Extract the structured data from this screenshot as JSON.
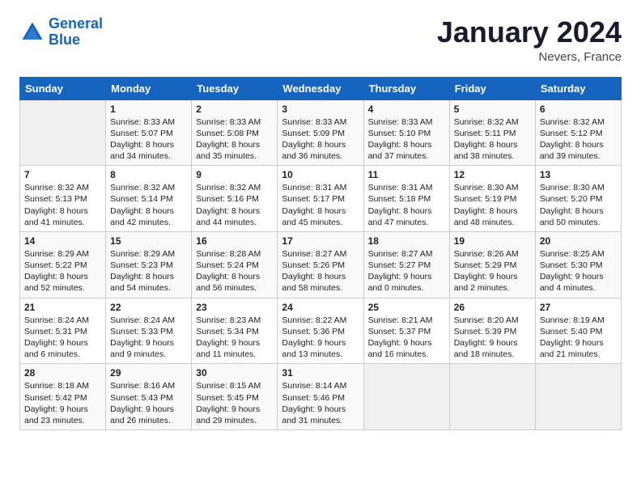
{
  "header": {
    "logo_line1": "General",
    "logo_line2": "Blue",
    "month_title": "January 2024",
    "location": "Nevers, France"
  },
  "days_of_week": [
    "Sunday",
    "Monday",
    "Tuesday",
    "Wednesday",
    "Thursday",
    "Friday",
    "Saturday"
  ],
  "weeks": [
    [
      {
        "day": "",
        "sunrise": "",
        "sunset": "",
        "daylight": ""
      },
      {
        "day": "1",
        "sunrise": "Sunrise: 8:33 AM",
        "sunset": "Sunset: 5:07 PM",
        "daylight": "Daylight: 8 hours and 34 minutes."
      },
      {
        "day": "2",
        "sunrise": "Sunrise: 8:33 AM",
        "sunset": "Sunset: 5:08 PM",
        "daylight": "Daylight: 8 hours and 35 minutes."
      },
      {
        "day": "3",
        "sunrise": "Sunrise: 8:33 AM",
        "sunset": "Sunset: 5:09 PM",
        "daylight": "Daylight: 8 hours and 36 minutes."
      },
      {
        "day": "4",
        "sunrise": "Sunrise: 8:33 AM",
        "sunset": "Sunset: 5:10 PM",
        "daylight": "Daylight: 8 hours and 37 minutes."
      },
      {
        "day": "5",
        "sunrise": "Sunrise: 8:32 AM",
        "sunset": "Sunset: 5:11 PM",
        "daylight": "Daylight: 8 hours and 38 minutes."
      },
      {
        "day": "6",
        "sunrise": "Sunrise: 8:32 AM",
        "sunset": "Sunset: 5:12 PM",
        "daylight": "Daylight: 8 hours and 39 minutes."
      }
    ],
    [
      {
        "day": "7",
        "sunrise": "Sunrise: 8:32 AM",
        "sunset": "Sunset: 5:13 PM",
        "daylight": "Daylight: 8 hours and 41 minutes."
      },
      {
        "day": "8",
        "sunrise": "Sunrise: 8:32 AM",
        "sunset": "Sunset: 5:14 PM",
        "daylight": "Daylight: 8 hours and 42 minutes."
      },
      {
        "day": "9",
        "sunrise": "Sunrise: 8:32 AM",
        "sunset": "Sunset: 5:16 PM",
        "daylight": "Daylight: 8 hours and 44 minutes."
      },
      {
        "day": "10",
        "sunrise": "Sunrise: 8:31 AM",
        "sunset": "Sunset: 5:17 PM",
        "daylight": "Daylight: 8 hours and 45 minutes."
      },
      {
        "day": "11",
        "sunrise": "Sunrise: 8:31 AM",
        "sunset": "Sunset: 5:18 PM",
        "daylight": "Daylight: 8 hours and 47 minutes."
      },
      {
        "day": "12",
        "sunrise": "Sunrise: 8:30 AM",
        "sunset": "Sunset: 5:19 PM",
        "daylight": "Daylight: 8 hours and 48 minutes."
      },
      {
        "day": "13",
        "sunrise": "Sunrise: 8:30 AM",
        "sunset": "Sunset: 5:20 PM",
        "daylight": "Daylight: 8 hours and 50 minutes."
      }
    ],
    [
      {
        "day": "14",
        "sunrise": "Sunrise: 8:29 AM",
        "sunset": "Sunset: 5:22 PM",
        "daylight": "Daylight: 8 hours and 52 minutes."
      },
      {
        "day": "15",
        "sunrise": "Sunrise: 8:29 AM",
        "sunset": "Sunset: 5:23 PM",
        "daylight": "Daylight: 8 hours and 54 minutes."
      },
      {
        "day": "16",
        "sunrise": "Sunrise: 8:28 AM",
        "sunset": "Sunset: 5:24 PM",
        "daylight": "Daylight: 8 hours and 56 minutes."
      },
      {
        "day": "17",
        "sunrise": "Sunrise: 8:27 AM",
        "sunset": "Sunset: 5:26 PM",
        "daylight": "Daylight: 8 hours and 58 minutes."
      },
      {
        "day": "18",
        "sunrise": "Sunrise: 8:27 AM",
        "sunset": "Sunset: 5:27 PM",
        "daylight": "Daylight: 9 hours and 0 minutes."
      },
      {
        "day": "19",
        "sunrise": "Sunrise: 8:26 AM",
        "sunset": "Sunset: 5:29 PM",
        "daylight": "Daylight: 9 hours and 2 minutes."
      },
      {
        "day": "20",
        "sunrise": "Sunrise: 8:25 AM",
        "sunset": "Sunset: 5:30 PM",
        "daylight": "Daylight: 9 hours and 4 minutes."
      }
    ],
    [
      {
        "day": "21",
        "sunrise": "Sunrise: 8:24 AM",
        "sunset": "Sunset: 5:31 PM",
        "daylight": "Daylight: 9 hours and 6 minutes."
      },
      {
        "day": "22",
        "sunrise": "Sunrise: 8:24 AM",
        "sunset": "Sunset: 5:33 PM",
        "daylight": "Daylight: 9 hours and 9 minutes."
      },
      {
        "day": "23",
        "sunrise": "Sunrise: 8:23 AM",
        "sunset": "Sunset: 5:34 PM",
        "daylight": "Daylight: 9 hours and 11 minutes."
      },
      {
        "day": "24",
        "sunrise": "Sunrise: 8:22 AM",
        "sunset": "Sunset: 5:36 PM",
        "daylight": "Daylight: 9 hours and 13 minutes."
      },
      {
        "day": "25",
        "sunrise": "Sunrise: 8:21 AM",
        "sunset": "Sunset: 5:37 PM",
        "daylight": "Daylight: 9 hours and 16 minutes."
      },
      {
        "day": "26",
        "sunrise": "Sunrise: 8:20 AM",
        "sunset": "Sunset: 5:39 PM",
        "daylight": "Daylight: 9 hours and 18 minutes."
      },
      {
        "day": "27",
        "sunrise": "Sunrise: 8:19 AM",
        "sunset": "Sunset: 5:40 PM",
        "daylight": "Daylight: 9 hours and 21 minutes."
      }
    ],
    [
      {
        "day": "28",
        "sunrise": "Sunrise: 8:18 AM",
        "sunset": "Sunset: 5:42 PM",
        "daylight": "Daylight: 9 hours and 23 minutes."
      },
      {
        "day": "29",
        "sunrise": "Sunrise: 8:16 AM",
        "sunset": "Sunset: 5:43 PM",
        "daylight": "Daylight: 9 hours and 26 minutes."
      },
      {
        "day": "30",
        "sunrise": "Sunrise: 8:15 AM",
        "sunset": "Sunset: 5:45 PM",
        "daylight": "Daylight: 9 hours and 29 minutes."
      },
      {
        "day": "31",
        "sunrise": "Sunrise: 8:14 AM",
        "sunset": "Sunset: 5:46 PM",
        "daylight": "Daylight: 9 hours and 31 minutes."
      },
      {
        "day": "",
        "sunrise": "",
        "sunset": "",
        "daylight": ""
      },
      {
        "day": "",
        "sunrise": "",
        "sunset": "",
        "daylight": ""
      },
      {
        "day": "",
        "sunrise": "",
        "sunset": "",
        "daylight": ""
      }
    ]
  ]
}
